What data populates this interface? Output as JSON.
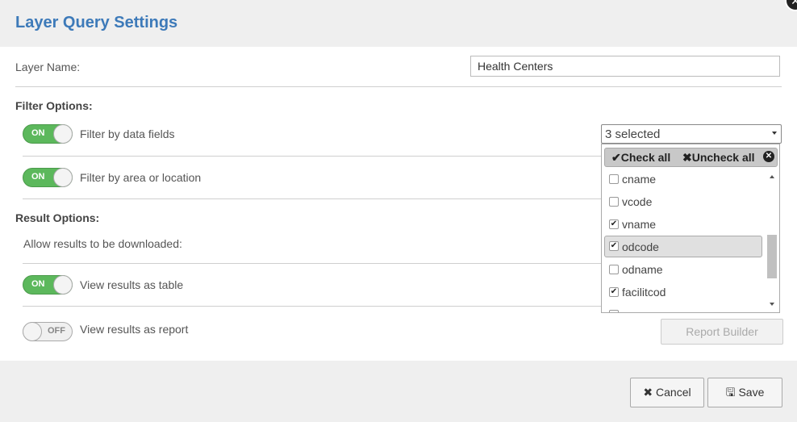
{
  "dialog": {
    "title": "Layer Query Settings"
  },
  "layer_name": {
    "label": "Layer Name:",
    "value": "Health Centers"
  },
  "filter_options": {
    "heading": "Filter Options:",
    "data_fields": {
      "label": "Filter by data fields",
      "toggle": "ON"
    },
    "area": {
      "label": "Filter by area or location",
      "toggle": "ON"
    }
  },
  "multiselect": {
    "selected_text": "3 selected",
    "check_all": "Check all",
    "uncheck_all": "Uncheck all",
    "options": [
      {
        "label": "cname",
        "checked": false
      },
      {
        "label": "vcode",
        "checked": false
      },
      {
        "label": "vname",
        "checked": true
      },
      {
        "label": "odcode",
        "checked": true
      },
      {
        "label": "odname",
        "checked": false
      },
      {
        "label": "facilitcod",
        "checked": true
      }
    ]
  },
  "result_options": {
    "heading": "Result Options:",
    "download_label": "Allow results to be downloaded:",
    "table": {
      "label": "View results as table",
      "toggle": "ON"
    },
    "report": {
      "label": "View results as report",
      "toggle": "OFF"
    },
    "report_builder": "Report Builder"
  },
  "footer": {
    "cancel": "Cancel",
    "save": "Save"
  }
}
